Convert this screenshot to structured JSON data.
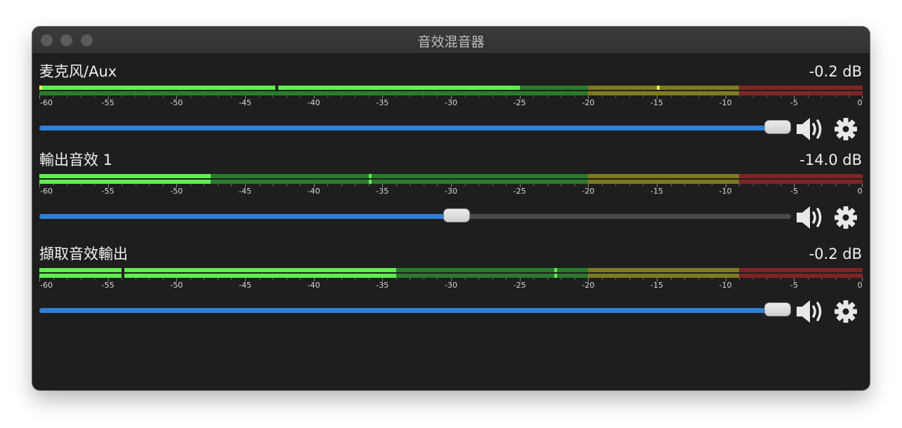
{
  "window": {
    "title": "音效混音器"
  },
  "scale": {
    "labels": [
      "-60",
      "-55",
      "-50",
      "-45",
      "-40",
      "-35",
      "-30",
      "-25",
      "-20",
      "-15",
      "-10",
      "-5",
      "0"
    ]
  },
  "colors": {
    "green_bright": "#5ef04c",
    "green_dark": "#2b7a2b",
    "yellow_dark": "#7d7a21",
    "red_dark": "#7c2626",
    "peak_yellow": "#f4f150",
    "slider_fill": "#2f7fd7"
  },
  "channels": [
    {
      "name": "麦克风/Aux",
      "db": "-0.2 dB",
      "volume": 0.99,
      "meter_row1_level_db": -25,
      "meter_row2_level_db": null,
      "row1_peak_db": -60,
      "row1_hold_db": -15,
      "row1_gap_db": -42.8,
      "icons": {
        "volume": "speaker-volume-icon",
        "settings": "gear-icon"
      }
    },
    {
      "name": "輸出音效 1",
      "db": "-14.0 dB",
      "volume": 0.555,
      "meter_row1_level_db": -47.5,
      "meter_row2_level_db": -47.5,
      "row1_peak_db": -60,
      "row1_hold_db": -36,
      "row2_peak_db": -60,
      "row2_hold_db": -36,
      "icons": {
        "volume": "speaker-volume-icon",
        "settings": "gear-icon"
      }
    },
    {
      "name": "擷取音效輸出",
      "db": "-0.2 dB",
      "volume": 0.99,
      "meter_row1_level_db": -34,
      "meter_row2_level_db": -34,
      "row1_peak_db": -60,
      "row1_hold_db": -22.5,
      "row2_peak_db": -60,
      "row2_hold_db": -22.5,
      "row1_gap_db": -54,
      "row2_gap_db": -54,
      "icons": {
        "volume": "speaker-volume-icon",
        "settings": "gear-icon"
      }
    }
  ]
}
